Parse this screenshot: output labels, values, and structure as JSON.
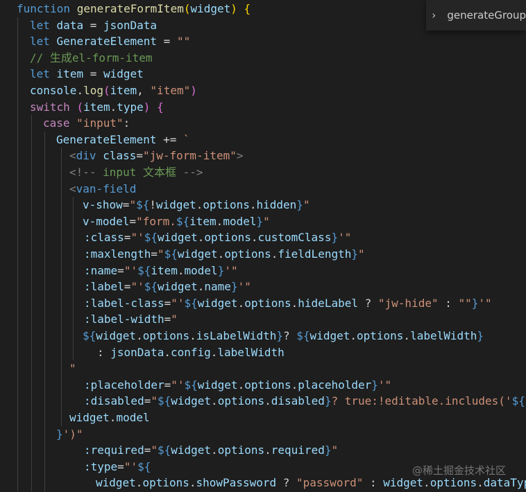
{
  "outline": {
    "chevron": "›",
    "label": "generateGroup"
  },
  "watermark": {
    "text": "@稀土掘金技术社区"
  },
  "colors": {
    "background": "#1e1e1e",
    "keyword": "#569cd6",
    "function": "#dcdcaa",
    "variable": "#9cdcfe",
    "string": "#ce9178",
    "comment": "#6a9955",
    "bracket_gold": "#ffd700",
    "bracket_pink": "#da70d6",
    "bracket_blue": "#179fff"
  },
  "code": {
    "lines": [
      [
        [
          "kw",
          "function"
        ],
        [
          "pl",
          " "
        ],
        [
          "fn",
          "generateFormItem"
        ],
        [
          "by",
          "("
        ],
        [
          "var",
          "widget"
        ],
        [
          "by",
          ")"
        ],
        [
          "pl",
          " "
        ],
        [
          "by",
          "{"
        ]
      ],
      [
        [
          "kw",
          "let"
        ],
        [
          "pl",
          " "
        ],
        [
          "var",
          "data"
        ],
        [
          "pl",
          " = "
        ],
        [
          "var",
          "jsonData"
        ]
      ],
      [
        [
          "kw",
          "let"
        ],
        [
          "pl",
          " "
        ],
        [
          "var",
          "GenerateElement"
        ],
        [
          "pl",
          " = "
        ],
        [
          "str",
          "\"\""
        ]
      ],
      [
        [
          "cm",
          "// 生成el-form-item"
        ]
      ],
      [
        [
          "kw",
          "let"
        ],
        [
          "pl",
          " "
        ],
        [
          "var",
          "item"
        ],
        [
          "pl",
          " = "
        ],
        [
          "var",
          "widget"
        ]
      ],
      [
        [
          "var",
          "console"
        ],
        [
          "pl",
          "."
        ],
        [
          "fn",
          "log"
        ],
        [
          "bp",
          "("
        ],
        [
          "var",
          "item"
        ],
        [
          "pl",
          ", "
        ],
        [
          "str",
          "\"item\""
        ],
        [
          "bp",
          ")"
        ]
      ],
      [
        [
          "ctl",
          "switch"
        ],
        [
          "pl",
          " "
        ],
        [
          "bp",
          "("
        ],
        [
          "var",
          "item"
        ],
        [
          "pl",
          "."
        ],
        [
          "var",
          "type"
        ],
        [
          "bp",
          ")"
        ],
        [
          "pl",
          " "
        ],
        [
          "bp",
          "{"
        ]
      ],
      [
        [
          "ctl",
          "case"
        ],
        [
          "pl",
          " "
        ],
        [
          "str",
          "\"input\""
        ],
        [
          "pl",
          ":"
        ]
      ],
      [
        [
          "var",
          "GenerateElement"
        ],
        [
          "pl",
          " += "
        ],
        [
          "str",
          "`"
        ]
      ],
      [
        [
          "punc",
          "<"
        ],
        [
          "tag",
          "div"
        ],
        [
          "pl",
          " "
        ],
        [
          "attr",
          "class"
        ],
        [
          "pl",
          "="
        ],
        [
          "str",
          "\"jw-form-item\""
        ],
        [
          "punc",
          ">"
        ]
      ],
      [
        [
          "punc",
          "<!--"
        ],
        [
          "cm",
          " input 文本框 "
        ],
        [
          "punc",
          "-->"
        ]
      ],
      [
        [
          "punc",
          "<"
        ],
        [
          "tag",
          "van-field"
        ]
      ],
      [
        [
          "attr",
          "v-show"
        ],
        [
          "pl",
          "="
        ],
        [
          "str",
          "\""
        ],
        [
          "kw",
          "${"
        ],
        [
          "pl",
          "!"
        ],
        [
          "var",
          "widget"
        ],
        [
          "pl",
          "."
        ],
        [
          "var",
          "options"
        ],
        [
          "pl",
          "."
        ],
        [
          "var",
          "hidden"
        ],
        [
          "kw",
          "}"
        ],
        [
          "str",
          "\""
        ]
      ],
      [
        [
          "attr",
          "v-model"
        ],
        [
          "pl",
          "="
        ],
        [
          "str",
          "\"form."
        ],
        [
          "kw",
          "${"
        ],
        [
          "var",
          "item"
        ],
        [
          "pl",
          "."
        ],
        [
          "var",
          "model"
        ],
        [
          "kw",
          "}"
        ],
        [
          "str",
          "\""
        ]
      ],
      [
        [
          "attr",
          ":class"
        ],
        [
          "pl",
          "="
        ],
        [
          "str",
          "\"'"
        ],
        [
          "kw",
          "${"
        ],
        [
          "var",
          "widget"
        ],
        [
          "pl",
          "."
        ],
        [
          "var",
          "options"
        ],
        [
          "pl",
          "."
        ],
        [
          "var",
          "customClass"
        ],
        [
          "kw",
          "}"
        ],
        [
          "str",
          "'\""
        ]
      ],
      [
        [
          "attr",
          ":maxlength"
        ],
        [
          "pl",
          "="
        ],
        [
          "str",
          "\""
        ],
        [
          "kw",
          "${"
        ],
        [
          "var",
          "widget"
        ],
        [
          "pl",
          "."
        ],
        [
          "var",
          "options"
        ],
        [
          "pl",
          "."
        ],
        [
          "var",
          "fieldLength"
        ],
        [
          "kw",
          "}"
        ],
        [
          "str",
          "\""
        ]
      ],
      [
        [
          "attr",
          ":name"
        ],
        [
          "pl",
          "="
        ],
        [
          "str",
          "\"'"
        ],
        [
          "kw",
          "${"
        ],
        [
          "var",
          "item"
        ],
        [
          "pl",
          "."
        ],
        [
          "var",
          "model"
        ],
        [
          "kw",
          "}"
        ],
        [
          "str",
          "'\""
        ]
      ],
      [
        [
          "attr",
          ":label"
        ],
        [
          "pl",
          "="
        ],
        [
          "str",
          "\"'"
        ],
        [
          "kw",
          "${"
        ],
        [
          "var",
          "widget"
        ],
        [
          "pl",
          "."
        ],
        [
          "var",
          "name"
        ],
        [
          "kw",
          "}"
        ],
        [
          "str",
          "'\""
        ]
      ],
      [
        [
          "attr",
          ":label-class"
        ],
        [
          "pl",
          "="
        ],
        [
          "str",
          "\"'"
        ],
        [
          "kw",
          "${"
        ],
        [
          "var",
          "widget"
        ],
        [
          "pl",
          "."
        ],
        [
          "var",
          "options"
        ],
        [
          "pl",
          "."
        ],
        [
          "var",
          "hideLabel"
        ],
        [
          "pl",
          " ? "
        ],
        [
          "str",
          "\"jw-hide\""
        ],
        [
          "pl",
          " : "
        ],
        [
          "str",
          "\"\""
        ],
        [
          "kw",
          "}"
        ],
        [
          "str",
          "'\""
        ]
      ],
      [
        [
          "attr",
          ":label-width"
        ],
        [
          "pl",
          "="
        ],
        [
          "str",
          "\""
        ]
      ],
      [
        [
          "kw",
          "${"
        ],
        [
          "var",
          "widget"
        ],
        [
          "pl",
          "."
        ],
        [
          "var",
          "options"
        ],
        [
          "pl",
          "."
        ],
        [
          "var",
          "isLabelWidth"
        ],
        [
          "kw",
          "}"
        ],
        [
          "pl",
          "? "
        ],
        [
          "kw",
          "${"
        ],
        [
          "var",
          "widget"
        ],
        [
          "pl",
          "."
        ],
        [
          "var",
          "options"
        ],
        [
          "pl",
          "."
        ],
        [
          "var",
          "labelWidth"
        ],
        [
          "kw",
          "}"
        ]
      ],
      [
        [
          "pl",
          ": "
        ],
        [
          "var",
          "jsonData"
        ],
        [
          "pl",
          "."
        ],
        [
          "var",
          "config"
        ],
        [
          "pl",
          "."
        ],
        [
          "var",
          "labelWidth"
        ]
      ],
      [
        [
          "str",
          "\""
        ]
      ],
      [
        [
          "attr",
          ":placeholder"
        ],
        [
          "pl",
          "="
        ],
        [
          "str",
          "\"'"
        ],
        [
          "kw",
          "${"
        ],
        [
          "var",
          "widget"
        ],
        [
          "pl",
          "."
        ],
        [
          "var",
          "options"
        ],
        [
          "pl",
          "."
        ],
        [
          "var",
          "placeholder"
        ],
        [
          "kw",
          "}"
        ],
        [
          "str",
          "'\""
        ]
      ],
      [
        [
          "attr",
          ":disabled"
        ],
        [
          "pl",
          "="
        ],
        [
          "str",
          "\""
        ],
        [
          "kw",
          "${"
        ],
        [
          "var",
          "widget"
        ],
        [
          "pl",
          "."
        ],
        [
          "var",
          "options"
        ],
        [
          "pl",
          "."
        ],
        [
          "var",
          "disabled"
        ],
        [
          "kw",
          "}"
        ],
        [
          "str",
          "? true:!editable.includes('"
        ],
        [
          "kw",
          "${"
        ]
      ],
      [
        [
          "var",
          "widget"
        ],
        [
          "pl",
          "."
        ],
        [
          "var",
          "model"
        ]
      ],
      [
        [
          "kw",
          "}"
        ],
        [
          "str",
          "')\""
        ]
      ],
      [
        [
          "attr",
          ":required"
        ],
        [
          "pl",
          "="
        ],
        [
          "str",
          "\""
        ],
        [
          "kw",
          "${"
        ],
        [
          "var",
          "widget"
        ],
        [
          "pl",
          "."
        ],
        [
          "var",
          "options"
        ],
        [
          "pl",
          "."
        ],
        [
          "var",
          "required"
        ],
        [
          "kw",
          "}"
        ],
        [
          "str",
          "\""
        ]
      ],
      [
        [
          "attr",
          ":type"
        ],
        [
          "pl",
          "="
        ],
        [
          "str",
          "\"'"
        ],
        [
          "kw",
          "${"
        ]
      ],
      [
        [
          "var",
          "widget"
        ],
        [
          "pl",
          "."
        ],
        [
          "var",
          "options"
        ],
        [
          "pl",
          "."
        ],
        [
          "var",
          "showPassword"
        ],
        [
          "pl",
          " ? "
        ],
        [
          "str",
          "\"password\""
        ],
        [
          "pl",
          " : "
        ],
        [
          "var",
          "widget"
        ],
        [
          "pl",
          "."
        ],
        [
          "var",
          "options"
        ],
        [
          "pl",
          "."
        ],
        [
          "var",
          "dataType"
        ]
      ]
    ]
  }
}
